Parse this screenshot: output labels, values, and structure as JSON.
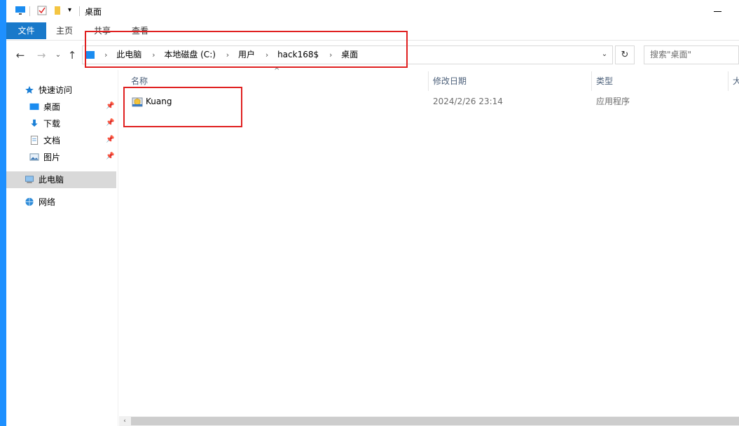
{
  "window": {
    "title": "桌面"
  },
  "ribbon": {
    "tabs": [
      "文件",
      "主页",
      "共享",
      "查看"
    ]
  },
  "navigation": {
    "breadcrumbs": [
      "此电脑",
      "本地磁盘 (C:)",
      "用户",
      "hack168$",
      "桌面"
    ],
    "search_placeholder": "搜索\"桌面\""
  },
  "sidebar": {
    "quick_access": "快速访问",
    "pinned": [
      "桌面",
      "下载",
      "文档",
      "图片"
    ],
    "this_pc": "此电脑",
    "network": "网络"
  },
  "columns": [
    "名称",
    "修改日期",
    "类型",
    "大"
  ],
  "files": [
    {
      "name": "Kuang",
      "modified": "2024/2/26 23:14",
      "type": "应用程序"
    }
  ],
  "colors": {
    "accent": "#1979ca",
    "highlight_box": "#e02020",
    "selected": "#d9d9d9"
  }
}
